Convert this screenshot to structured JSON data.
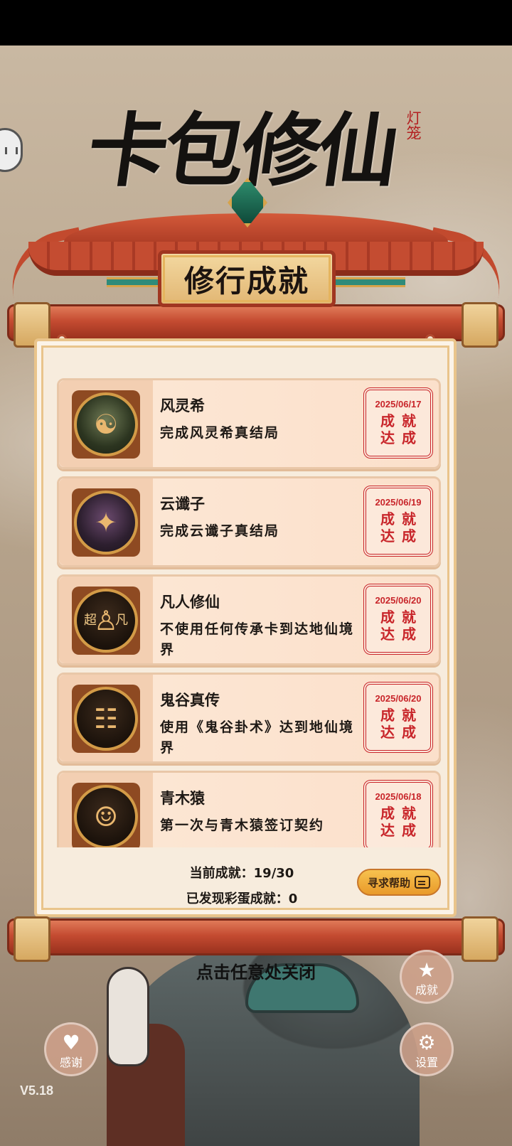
{
  "logo": {
    "title": "卡包修仙",
    "seal": "灯笼"
  },
  "header": {
    "plaque": "修行成就"
  },
  "achievements": [
    {
      "title": "风灵希",
      "desc": "完成风灵希真结局",
      "date": "2025/06/17",
      "stamp": [
        "成",
        "就",
        "达",
        "成"
      ],
      "icon": "portrait-fenglingxi-icon"
    },
    {
      "title": "云谶子",
      "desc": "完成云谶子真结局",
      "date": "2025/06/19",
      "stamp": [
        "成",
        "就",
        "达",
        "成"
      ],
      "icon": "portrait-yunchenzi-icon"
    },
    {
      "title": "凡人修仙",
      "desc": "不使用任何传承卡到达地仙境界",
      "date": "2025/06/20",
      "stamp": [
        "成",
        "就",
        "达",
        "成"
      ],
      "icon": "mortal-cultivation-icon",
      "icon_text": [
        "超",
        "凡"
      ]
    },
    {
      "title": "鬼谷真传",
      "desc": "使用《鬼谷卦术》达到地仙境界",
      "date": "2025/06/20",
      "stamp": [
        "成",
        "就",
        "达",
        "成"
      ],
      "icon": "divination-turtle-icon"
    },
    {
      "title": "青木猿",
      "desc": "第一次与青木猿签订契约",
      "date": "2025/06/18",
      "stamp": [
        "成",
        "就",
        "达",
        "成"
      ],
      "icon": "green-ape-icon"
    }
  ],
  "summary": {
    "current": "当前成就：19/30",
    "eggs": "已发现彩蛋成就：0",
    "help_label": "寻求帮助"
  },
  "close_hint": "点击任意处关闭",
  "buttons": {
    "achievements": "成就",
    "thanks": "感谢",
    "settings": "设置"
  },
  "version": "V5.18",
  "colors": {
    "stamp_red": "#c8252a",
    "scroll_red": "#c44b31",
    "panel_bg": "#f7ecdd",
    "help_btn": "#f7c24f"
  }
}
